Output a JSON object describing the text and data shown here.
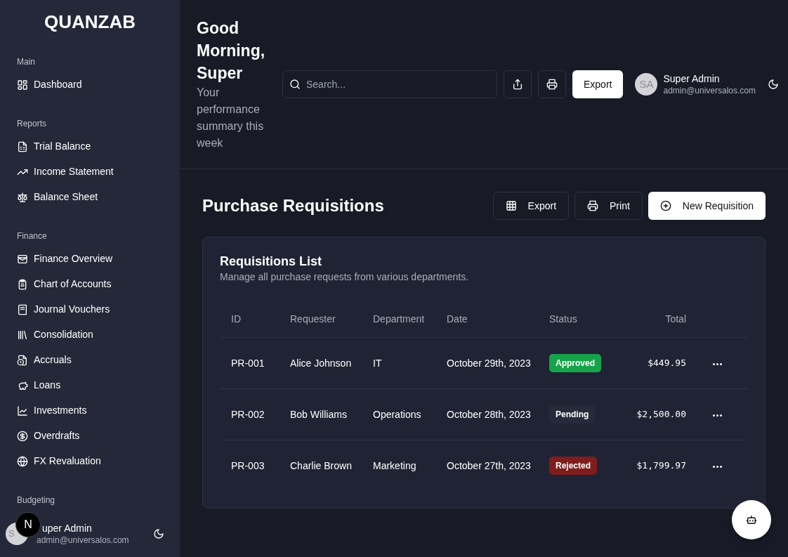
{
  "sidebar": {
    "logo": "QUANZAB",
    "sections": [
      {
        "title": "Main",
        "items": [
          "Dashboard"
        ]
      },
      {
        "title": "Reports",
        "items": [
          "Trial Balance",
          "Income Statement",
          "Balance Sheet"
        ]
      },
      {
        "title": "Finance",
        "items": [
          "Finance Overview",
          "Chart of Accounts",
          "Journal Vouchers",
          "Consolidation",
          "Accruals",
          "Loans",
          "Investments",
          "Overdrafts",
          "FX Revaluation"
        ]
      },
      {
        "title": "Budgeting"
      }
    ],
    "user": {
      "initials": "S",
      "name": "uper Admin",
      "email": "admin@universalos.com"
    },
    "dev_badge": "N"
  },
  "header": {
    "greeting": "Good Morning, Super",
    "subtitle": "Your performance summary this week",
    "search": {
      "placeholder": "Search..."
    },
    "export_button": "Export",
    "user": {
      "initials": "SA",
      "name": "Super Admin",
      "email": "admin@universalos.com"
    }
  },
  "page": {
    "title": "Purchase Requisitions",
    "buttons": [
      "Export",
      "Print",
      "New Requisition"
    ],
    "card": {
      "title": "Requisitions List",
      "subtitle": "Manage all purchase requests from various departments.",
      "columns": [
        "ID",
        "Requester",
        "Department",
        "Date",
        "Status",
        "Total"
      ],
      "rows": [
        {
          "id": "PR-001",
          "requester": "Alice Johnson",
          "department": "IT",
          "date": "October 29th, 2023",
          "status": "Approved",
          "color": "#16a34a",
          "total": "$449.95"
        },
        {
          "id": "PR-002",
          "requester": "Bob Williams",
          "department": "Operations",
          "date": "October 28th, 2023",
          "status": "Pending",
          "color": "#262a3a",
          "total": "$2,500.00"
        },
        {
          "id": "PR-003",
          "requester": "Charlie Brown",
          "department": "Marketing",
          "date": "October 27th, 2023",
          "status": "Rejected",
          "color": "#7f1d1d",
          "total": "$1,799.97"
        }
      ]
    }
  }
}
